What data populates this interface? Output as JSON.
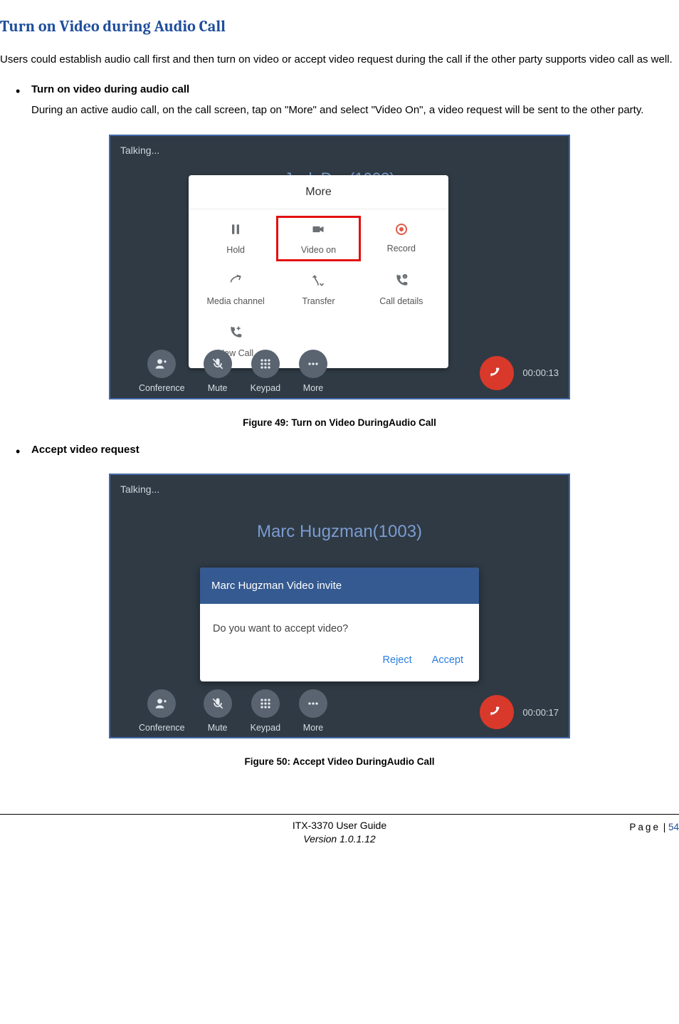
{
  "heading": "Turn on Video during Audio Call",
  "intro": "Users could establish audio call first and then turn on video or accept video request during the call if the other party supports video call as well.",
  "bullets": {
    "turn_on": {
      "title": "Turn on video during audio call",
      "body": "During an active audio call, on the call screen, tap on \"More\" and select \"Video On\", a video request will be sent to the other party."
    },
    "accept": {
      "title": "Accept video request"
    }
  },
  "figure1": {
    "caption": "Figure 49: Turn on Video DuringAudio Call",
    "status": "Talking...",
    "caller": "Jack Doe(1002)",
    "popup_title": "More",
    "items": {
      "hold": "Hold",
      "video_on": "Video on",
      "record": "Record",
      "media_channel": "Media channel",
      "transfer": "Transfer",
      "call_details": "Call details",
      "new_call": "New Call"
    },
    "dock": {
      "conference": "Conference",
      "mute": "Mute",
      "keypad": "Keypad",
      "more": "More"
    },
    "timer": "00:00:13"
  },
  "figure2": {
    "caption": "Figure 50: Accept Video DuringAudio Call",
    "status": "Talking...",
    "caller": "Marc Hugzman(1003)",
    "dialog": {
      "title": "Marc Hugzman Video invite",
      "body": "Do you want to accept video?",
      "reject": "Reject",
      "accept": "Accept"
    },
    "dock": {
      "conference": "Conference",
      "mute": "Mute",
      "keypad": "Keypad",
      "more": "More"
    },
    "timer": "00:00:17"
  },
  "footer": {
    "page_word": "Page",
    "page_sep": " | ",
    "page_num": "54",
    "line1": "ITX-3370 User Guide",
    "line2": "Version 1.0.1.12"
  }
}
